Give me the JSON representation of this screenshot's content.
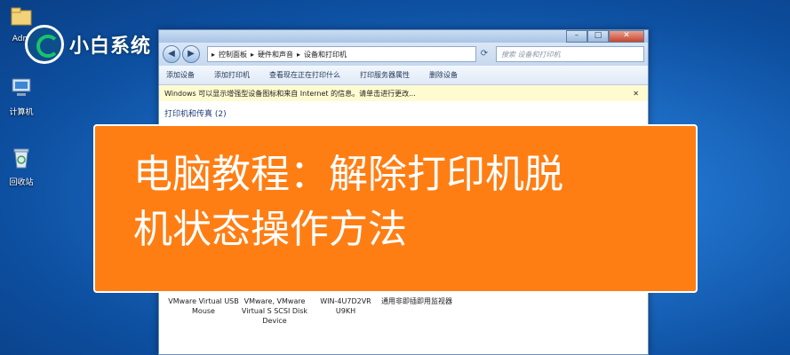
{
  "desktop": {
    "icons": [
      {
        "label": "Adm",
        "icon": "user-folder-icon"
      },
      {
        "label": "计算机",
        "icon": "computer-icon"
      },
      {
        "label": "回收站",
        "icon": "recycle-bin-icon"
      }
    ]
  },
  "watermark": {
    "text": "小白系统"
  },
  "window": {
    "controls": {
      "minimize": "–",
      "maximize": "□",
      "close": "✕"
    },
    "breadcrumb": [
      "控制面板",
      "硬件和声音",
      "设备和打印机"
    ],
    "search_placeholder": "搜索 设备和打印机",
    "toolbar": [
      "添加设备",
      "添加打印机",
      "查看现在正在打印什么",
      "打印服务器属性",
      "删除设备"
    ],
    "infobar": "Windows 可以显示增强型设备图标和来自 Internet 的信息。请单击进行更改...",
    "section_title": "打印机和传真 (2)",
    "devices": [
      {
        "label": "VMware Virtual USB Mouse"
      },
      {
        "label": "VMware, VMware Virtual S SCSI Disk Device"
      },
      {
        "label": "WIN-4U7D2VR U9KH"
      },
      {
        "label": "通用非即插即用监视器"
      }
    ]
  },
  "banner": {
    "line1": "电脑教程：解除打印机脱",
    "line2": "机状态操作方法",
    "color": "#ff7e14"
  }
}
